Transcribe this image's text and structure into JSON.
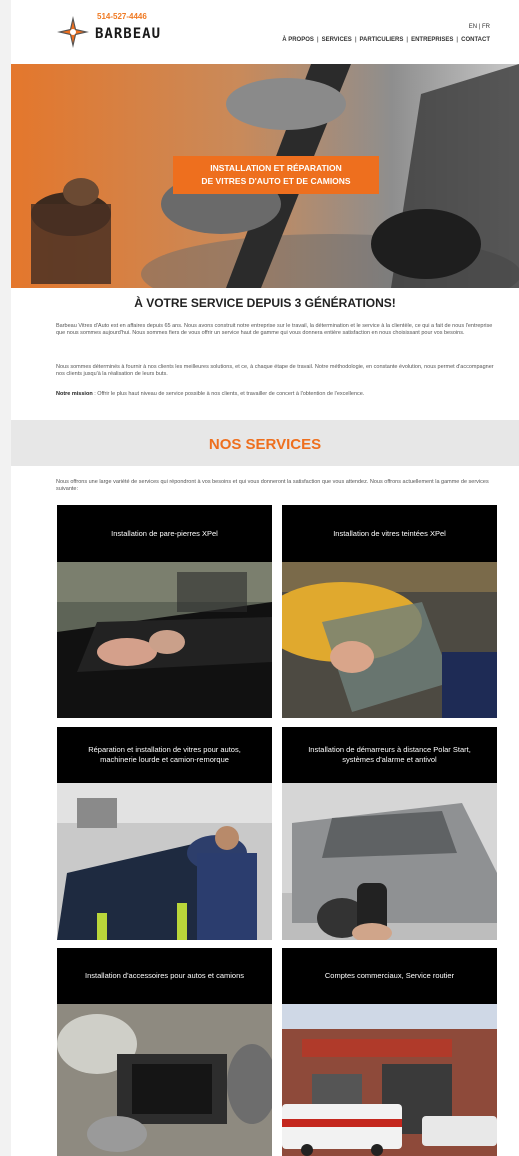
{
  "header": {
    "phone": "514-527-4446",
    "brand": "BARBEAU",
    "lang": [
      "EN",
      "FR"
    ],
    "nav": [
      "À PROPOS",
      "SERVICES",
      "PARTICULIERS",
      "ENTREPRISES",
      "CONTACT"
    ]
  },
  "hero": {
    "line1": "INSTALLATION ET RÉPARATION",
    "line2": "DE VITRES D'AUTO ET DE CAMIONS"
  },
  "intro": {
    "title": "À VOTRE SERVICE DEPUIS 3 GÉNÉRATIONS!",
    "p1": "Barbeau Vitres d'Auto est en affaires depuis 65 ans. Nous avons construit notre entreprise sur le travail, la détermination et le service à la clientèle, ce qui a fait de nous l'entreprise que nous sommes aujourd'hui. Nous sommes fiers de vous offrir un service haut de gamme qui vous donnera entière satisfaction en nous choisissant pour vos besoins.",
    "p2": "Nous sommes déterminés à fournir à nos clients les meilleures solutions, et ce, à chaque étape de travail. Notre méthodologie, en constante évolution, nous permet d'accompagner nos clients jusqu'à la réalisation de leurs buts.",
    "mission_label": "Notre mission",
    "mission_text": " : Offrir le plus haut niveau de service possible à nos clients, et travailler de concert à l'obtention de l'excellence."
  },
  "services": {
    "title": "NOS SERVICES",
    "intro": "Nous offrons une large variété de services qui répondront à vos besoins et qui vous donneront la satisfaction que vous attendez. Nous offrons actuellement la gamme de services suivante:",
    "cards": [
      {
        "title": "Installation de pare-pierres XPel"
      },
      {
        "title": "Installation de vitres teintées XPel"
      },
      {
        "title": "Réparation et installation de vitres pour autos, machinerie lourde et camion-remorque"
      },
      {
        "title": "Installation de démarreurs à distance Polar Start, systèmes d'alarme et antivol"
      },
      {
        "title": "Installation d'accessoires pour autos et camions"
      },
      {
        "title": "Comptes commerciaux, Service routier"
      }
    ]
  },
  "colors": {
    "accent": "#ee6f1e",
    "card_header": "#000000",
    "band": "#e7e7e7"
  }
}
